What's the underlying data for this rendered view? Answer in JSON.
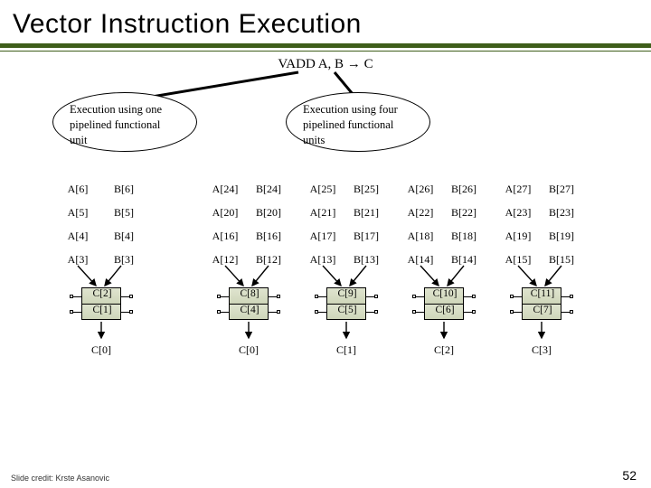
{
  "title": "Vector Instruction Execution",
  "instruction": "VADD A, B → C",
  "bubbles": {
    "left": "Execution using one pipelined functional unit",
    "right": "Execution using four pipelined functional units"
  },
  "left_block": {
    "rows": [
      {
        "a": "A[6]",
        "b": "B[6]"
      },
      {
        "a": "A[5]",
        "b": "B[5]"
      },
      {
        "a": "A[4]",
        "b": "B[4]"
      },
      {
        "a": "A[3]",
        "b": "B[3]"
      }
    ],
    "stages": [
      "C[2]",
      "C[1]"
    ],
    "out": "C[0]"
  },
  "right_block": {
    "columns": [
      {
        "rows": [
          {
            "a": "A[24]",
            "b": "B[24]"
          },
          {
            "a": "A[20]",
            "b": "B[20]"
          },
          {
            "a": "A[16]",
            "b": "B[16]"
          },
          {
            "a": "A[12]",
            "b": "B[12]"
          }
        ],
        "stages": [
          "C[8]",
          "C[4]"
        ],
        "out": "C[0]"
      },
      {
        "rows": [
          {
            "a": "A[25]",
            "b": "B[25]"
          },
          {
            "a": "A[21]",
            "b": "B[21]"
          },
          {
            "a": "A[17]",
            "b": "B[17]"
          },
          {
            "a": "A[13]",
            "b": "B[13]"
          }
        ],
        "stages": [
          "C[9]",
          "C[5]"
        ],
        "out": "C[1]"
      },
      {
        "rows": [
          {
            "a": "A[26]",
            "b": "B[26]"
          },
          {
            "a": "A[22]",
            "b": "B[22]"
          },
          {
            "a": "A[18]",
            "b": "B[18]"
          },
          {
            "a": "A[14]",
            "b": "B[14]"
          }
        ],
        "stages": [
          "C[10]",
          "C[6]"
        ],
        "out": "C[2]"
      },
      {
        "rows": [
          {
            "a": "A[27]",
            "b": "B[27]"
          },
          {
            "a": "A[23]",
            "b": "B[23]"
          },
          {
            "a": "A[19]",
            "b": "B[19]"
          },
          {
            "a": "A[15]",
            "b": "B[15]"
          }
        ],
        "stages": [
          "C[11]",
          "C[7]"
        ],
        "out": "C[3]"
      }
    ]
  },
  "footer": "Slide credit: Krste Asanovic",
  "page": "52"
}
